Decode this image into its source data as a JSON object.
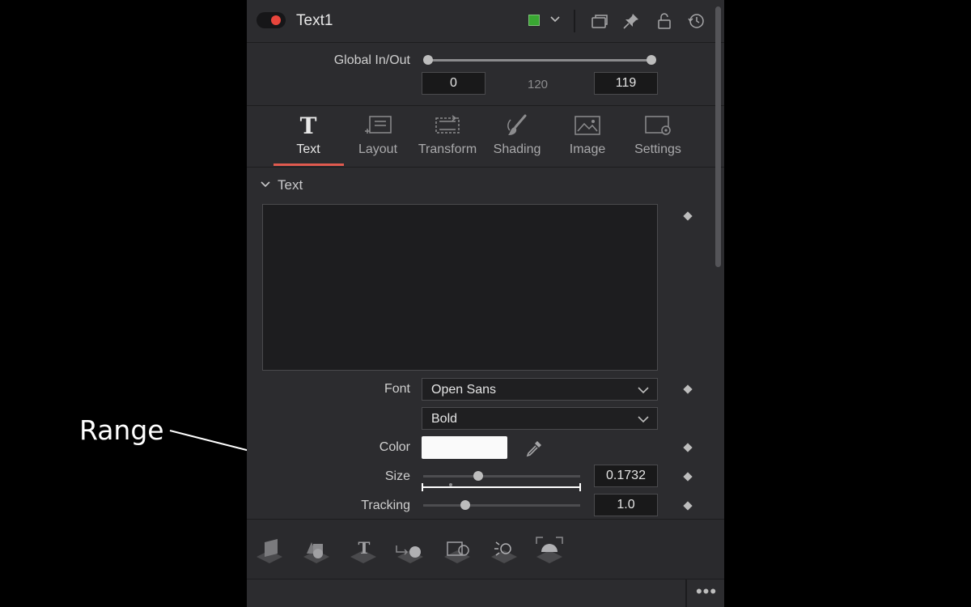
{
  "header": {
    "title": "Text1",
    "accent_color": "#39a732",
    "icons": [
      "toggle-icon",
      "chevron-down-icon",
      "windows-icon",
      "pin-icon",
      "lock-icon",
      "reset-icon"
    ]
  },
  "global_in_out": {
    "label": "Global In/Out",
    "in_value": "0",
    "mid_value": "120",
    "out_value": "119"
  },
  "tabs": [
    {
      "label": "Text",
      "active": true
    },
    {
      "label": "Layout",
      "active": false
    },
    {
      "label": "Transform",
      "active": false
    },
    {
      "label": "Shading",
      "active": false
    },
    {
      "label": "Image",
      "active": false
    },
    {
      "label": "Settings",
      "active": false
    }
  ],
  "text_section": {
    "heading": "Text",
    "styled_text": ""
  },
  "properties": {
    "font_label": "Font",
    "font_value": "Open Sans",
    "style_value": "Bold",
    "color_label": "Color",
    "color_value": "#fafafa",
    "size_label": "Size",
    "size_value": "0.1732",
    "size_slider_fraction": 0.35,
    "tracking_label": "Tracking",
    "tracking_value": "1.0",
    "tracking_slider_fraction": 0.27
  },
  "toolbar": {
    "tools": [
      "image-plane-icon",
      "shape-3d-icon",
      "text-3d-icon",
      "render-icon",
      "camera-3d-icon",
      "light-icon",
      "renderer-3d-icon"
    ],
    "more_label": "•••"
  },
  "annotation": {
    "label": "Range"
  }
}
